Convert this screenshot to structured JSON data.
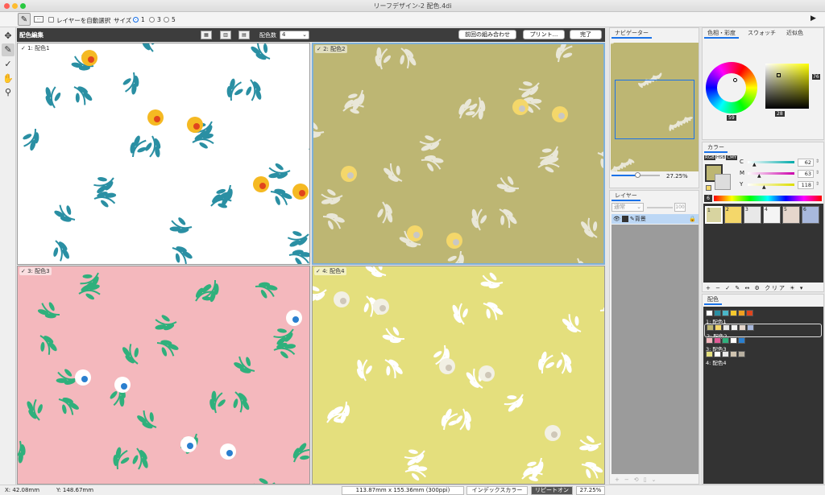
{
  "window": {
    "title": "リーフデザイン-2 配色.4di"
  },
  "options": {
    "auto_select_label": "レイヤーを自動選択",
    "size_label": "サイズ",
    "size_options": [
      "1",
      "3",
      "5"
    ]
  },
  "doc": {
    "title": "配色編集",
    "color_count_label": "配色数",
    "color_count_value": "4",
    "btn_prev": "前回の組み合わせ",
    "btn_print": "プリント...",
    "btn_done": "完了"
  },
  "quads": [
    {
      "label": "1: 配色1",
      "bg": "#ffffff",
      "leaf": "#2a8fa3",
      "flower": "#f5b922",
      "accent": "#e0451d"
    },
    {
      "label": "2: 配色2",
      "bg": "#bdb673",
      "leaf": "#e9e7d8",
      "flower": "#f4d76a",
      "accent": "#c9c7c4"
    },
    {
      "label": "3: 配色3",
      "bg": "#f4b8bd",
      "leaf": "#2fb07c",
      "flower": "#ffffff",
      "accent": "#2a7fcf"
    },
    {
      "label": "4: 配色4",
      "bg": "#e4df7d",
      "leaf": "#ffffff",
      "flower": "#f2f0e4",
      "accent": "#cfc7b8"
    }
  ],
  "navigator": {
    "tab": "ナビゲーター",
    "zoom": "27.25%"
  },
  "layers": {
    "tab": "レイヤー",
    "blend": "通常",
    "opacity": "100",
    "layer_name": "背景"
  },
  "color_panel": {
    "tabs": [
      "色相・彩度",
      "スウォッチ",
      "近似色"
    ],
    "hue_value": "59",
    "sat_value": "76",
    "bright_value": "28"
  },
  "color_mix": {
    "tab": "カラー",
    "modes": [
      "RGB",
      "HSB",
      "CMY"
    ],
    "channels": [
      {
        "name": "C",
        "value": "62"
      },
      {
        "name": "M",
        "value": "63"
      },
      {
        "name": "Y",
        "value": "118"
      }
    ],
    "index": "6"
  },
  "palette": {
    "swatches": [
      {
        "num": "1",
        "color": "#d8d4a0"
      },
      {
        "num": "2",
        "color": "#f4d76a"
      },
      {
        "num": "3",
        "color": "#e8e8e8"
      },
      {
        "num": "4",
        "color": "#f4f4f4"
      },
      {
        "num": "5",
        "color": "#e5d6cc"
      },
      {
        "num": "6",
        "color": "#a8b8dc"
      }
    ],
    "clear_label": "クリア"
  },
  "schemes": {
    "tab": "配色",
    "items": [
      {
        "label": "1: 配色1",
        "colors": [
          "#ffffff",
          "#2a8fa3",
          "#4bb6c8",
          "#f5c82e",
          "#f0a020",
          "#e0451d"
        ]
      },
      {
        "label": "2: 配色2",
        "colors": [
          "#bdb673",
          "#f4d76a",
          "#e8e8e8",
          "#f4f4f4",
          "#e5d6cc",
          "#a8b8dc"
        ]
      },
      {
        "label": "3: 配色3",
        "colors": [
          "#f4b8bd",
          "#e05a95",
          "#2fb07c",
          "#ffffff",
          "#2a7fcf"
        ]
      },
      {
        "label": "4: 配色4",
        "colors": [
          "#e4df7d",
          "#ffffff",
          "#e8e8e8",
          "#d0c4b0",
          "#b8b0a0"
        ]
      }
    ]
  },
  "status": {
    "x": "X:   42.08mm",
    "y": "Y:   148.67mm",
    "dims": "113.87mm x 155.36mm (300ppi)",
    "index_color": "インデックスカラー",
    "repeat": "リピートオン",
    "zoom": "27.25%"
  }
}
